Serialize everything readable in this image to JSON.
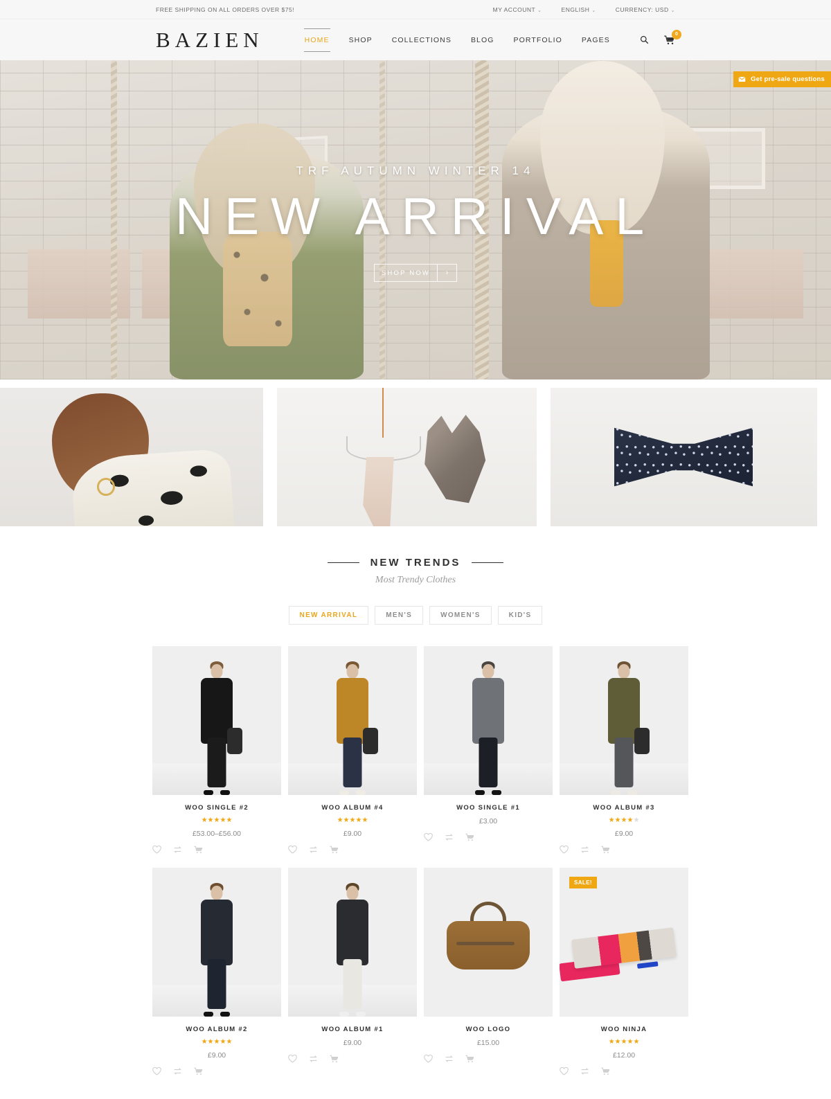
{
  "topbar": {
    "promo": "FREE SHIPPING ON ALL ORDERS OVER $75!",
    "links": [
      {
        "label": "MY ACCOUNT",
        "caret": "⌄"
      },
      {
        "label": "ENGLISH",
        "caret": "⌄"
      },
      {
        "label": "CURRENCY: USD",
        "caret": "⌄"
      }
    ]
  },
  "header": {
    "logo": "BAZIEN",
    "nav": [
      {
        "label": "HOME",
        "active": true
      },
      {
        "label": "SHOP",
        "active": false
      },
      {
        "label": "COLLECTIONS",
        "active": false
      },
      {
        "label": "BLOG",
        "active": false
      },
      {
        "label": "PORTFOLIO",
        "active": false
      },
      {
        "label": "PAGES",
        "active": false
      }
    ],
    "search_icon": "search-icon",
    "cart_icon": "cart-icon",
    "cart_count": "0",
    "accent_color": "#efa713"
  },
  "hero": {
    "subtitle": "TRF AUTUMN WINTER 14",
    "title": "NEW ARRIVAL",
    "cta_label": "SHOP NOW",
    "cta_arrow": "›"
  },
  "presale": {
    "label": "Get pre-sale questions",
    "icon": "envelope-icon",
    "color": "#efa713"
  },
  "trends": {
    "title": "NEW TRENDS",
    "subtitle": "Most Trendy Clothes",
    "filters": [
      {
        "label": "NEW ARRIVAL",
        "active": true
      },
      {
        "label": "MEN'S",
        "active": false
      },
      {
        "label": "WOMEN'S",
        "active": false
      },
      {
        "label": "KID'S",
        "active": false
      }
    ]
  },
  "products": [
    {
      "name": "WOO SINGLE #2",
      "price": "£53.00–£56.00",
      "rating": 5,
      "badge": "",
      "type": "model-black"
    },
    {
      "name": "WOO ALBUM #4",
      "price": "£9.00",
      "rating": 5,
      "badge": "",
      "type": "model-mustard"
    },
    {
      "name": "WOO SINGLE #1",
      "price": "£3.00",
      "rating": 0,
      "badge": "",
      "type": "model-grey"
    },
    {
      "name": "WOO ALBUM #3",
      "price": "£9.00",
      "rating": 3.5,
      "badge": "",
      "type": "model-olive"
    },
    {
      "name": "WOO ALBUM #2",
      "price": "£9.00",
      "rating": 4.5,
      "badge": "",
      "type": "model-navy"
    },
    {
      "name": "WOO ALBUM #1",
      "price": "£9.00",
      "rating": 0,
      "badge": "",
      "type": "model-darkparka"
    },
    {
      "name": "WOO LOGO",
      "price": "£15.00",
      "rating": 0,
      "badge": "",
      "type": "bag"
    },
    {
      "name": "WOO NINJA",
      "price": "£12.00",
      "rating": 4.5,
      "badge": "SALE!",
      "type": "scarf"
    }
  ],
  "product_actions": [
    {
      "name": "wishlist-icon"
    },
    {
      "name": "compare-icon"
    },
    {
      "name": "add-to-cart-icon"
    }
  ]
}
